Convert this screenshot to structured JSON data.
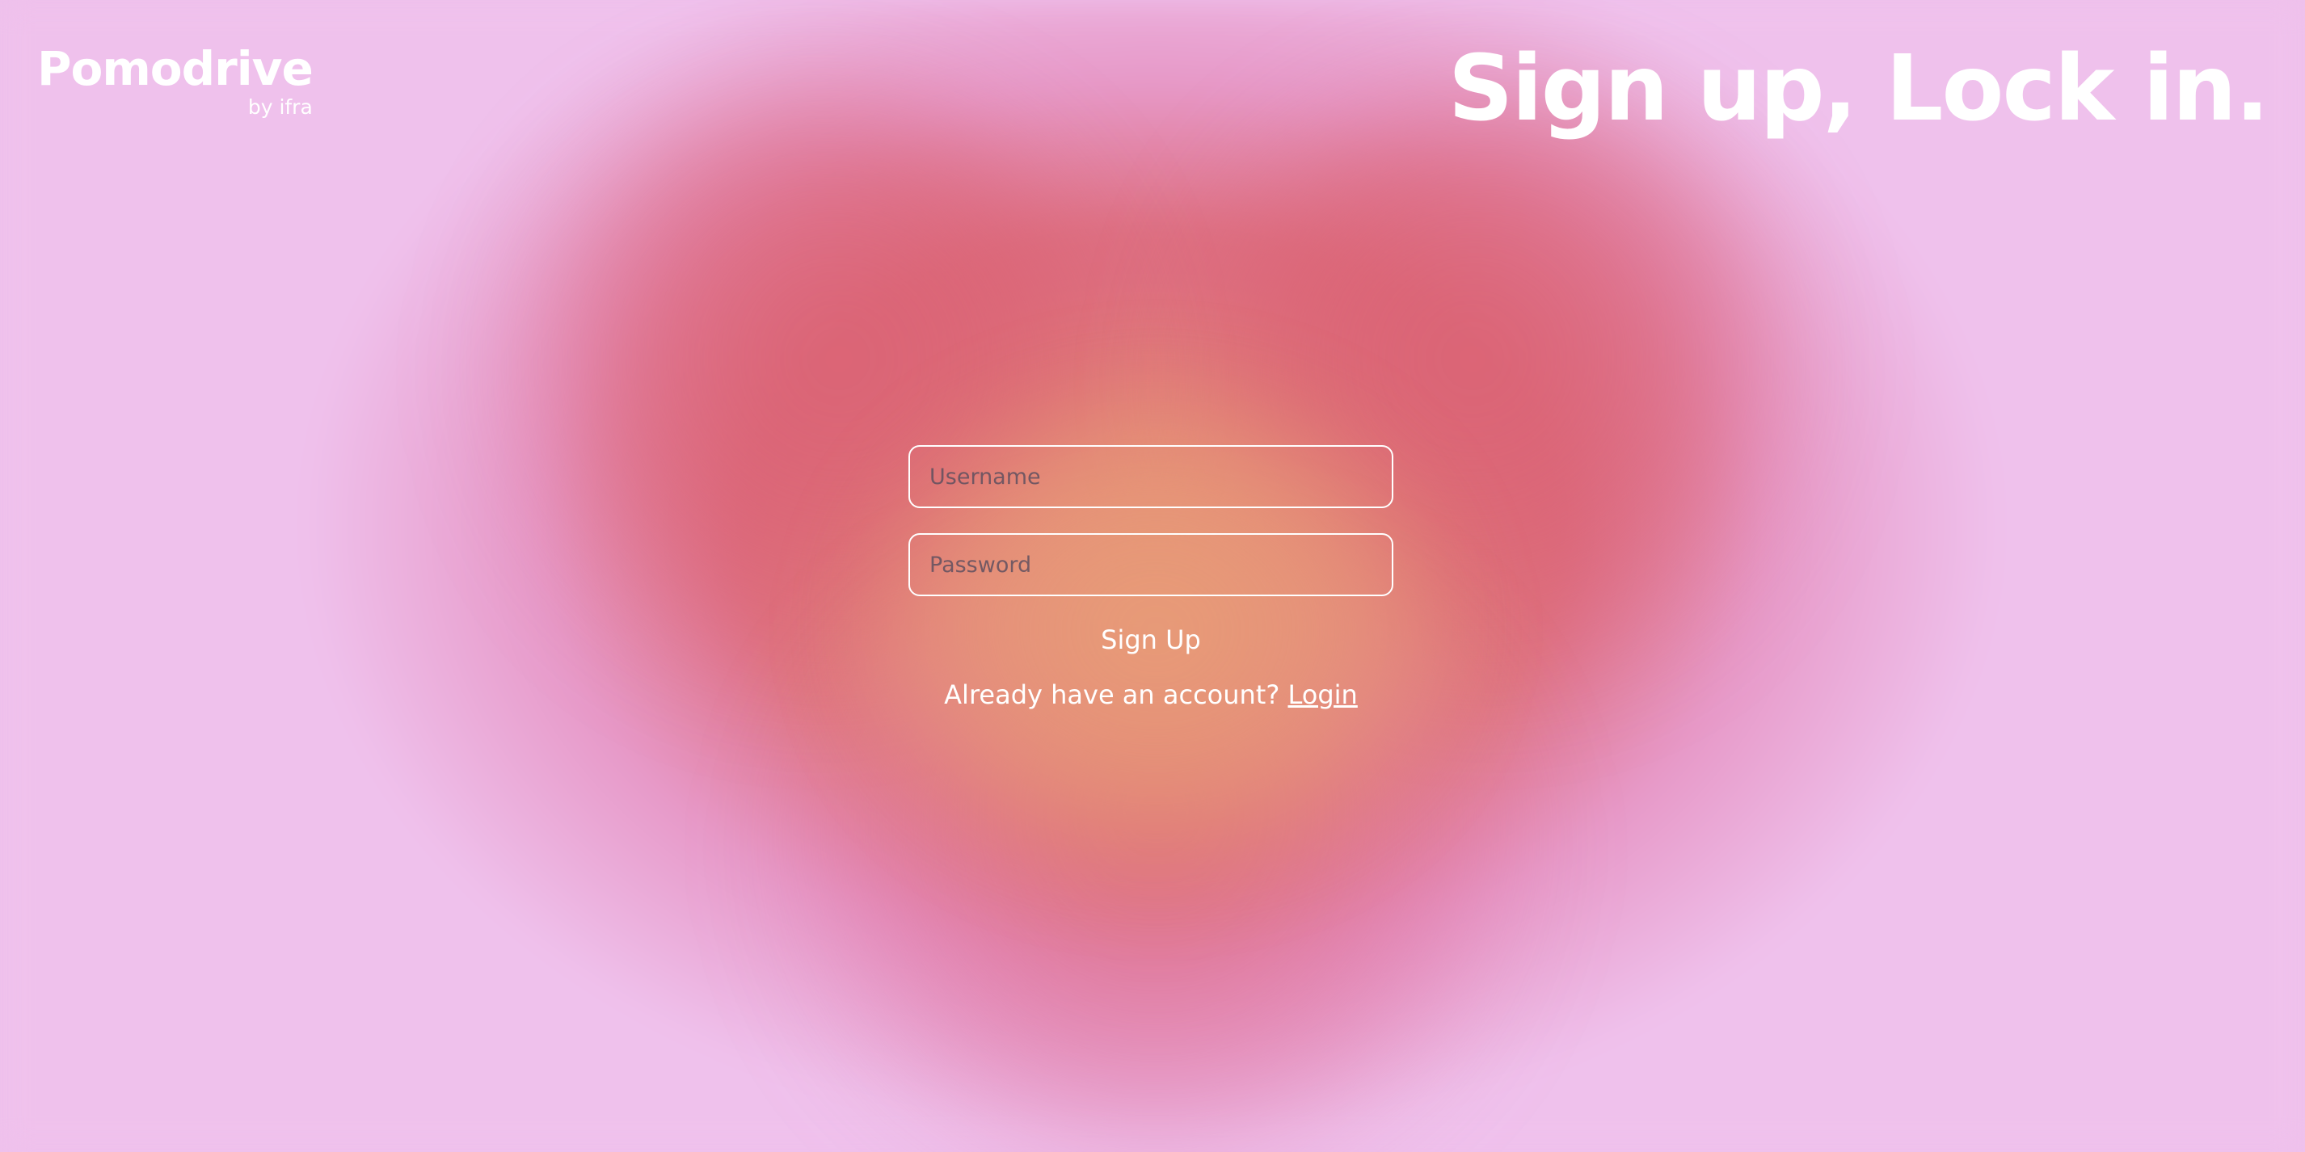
{
  "brand": {
    "name": "Pomodrive",
    "byline": "by ifra"
  },
  "headline": "Sign up, Lock in.",
  "form": {
    "username_placeholder": "Username",
    "password_placeholder": "Password",
    "submit_label": "Sign Up",
    "login_prompt": "Already have an account?",
    "login_link": "Login"
  },
  "colors": {
    "background": "#efc1ec",
    "heart_outer": "#db6270",
    "heart_core": "#e89e76",
    "text": "#ffffff"
  }
}
